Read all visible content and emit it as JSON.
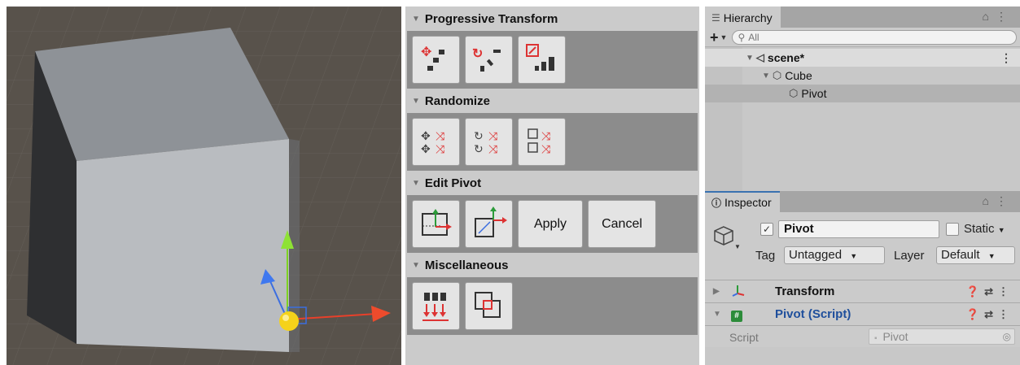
{
  "toolpanel": {
    "sections": [
      {
        "title": "Progressive Transform",
        "buttons": [
          "progressive-move",
          "progressive-rotate",
          "progressive-scale"
        ]
      },
      {
        "title": "Randomize",
        "buttons": [
          "randomize-move",
          "randomize-rotate",
          "randomize-scale"
        ]
      },
      {
        "title": "Edit Pivot",
        "buttons": [
          "pivot-move",
          "pivot-axis"
        ],
        "text_buttons": [
          "Apply",
          "Cancel"
        ]
      },
      {
        "title": "Miscellaneous",
        "buttons": [
          "distribute",
          "snap"
        ]
      }
    ]
  },
  "hierarchy": {
    "tab_label": "Hierarchy",
    "search_placeholder": "All",
    "items": [
      {
        "label": "scene*"
      },
      {
        "label": "Cube"
      },
      {
        "label": "Pivot"
      }
    ]
  },
  "inspector": {
    "tab_label": "Inspector",
    "object_name": "Pivot",
    "static_label": "Static",
    "tag_label": "Tag",
    "tag_value": "Untagged",
    "layer_label": "Layer",
    "layer_value": "Default",
    "components": [
      {
        "title": "Transform"
      },
      {
        "title": "Pivot (Script)"
      }
    ],
    "script_label": "Script",
    "script_value": "Pivot"
  },
  "colors": {
    "accent_blue": "#3a72b0",
    "gizmo_red": "#e8402a",
    "gizmo_green": "#7ed321",
    "gizmo_blue": "#3b6ee0",
    "pivot_yellow": "#f5d21a"
  }
}
